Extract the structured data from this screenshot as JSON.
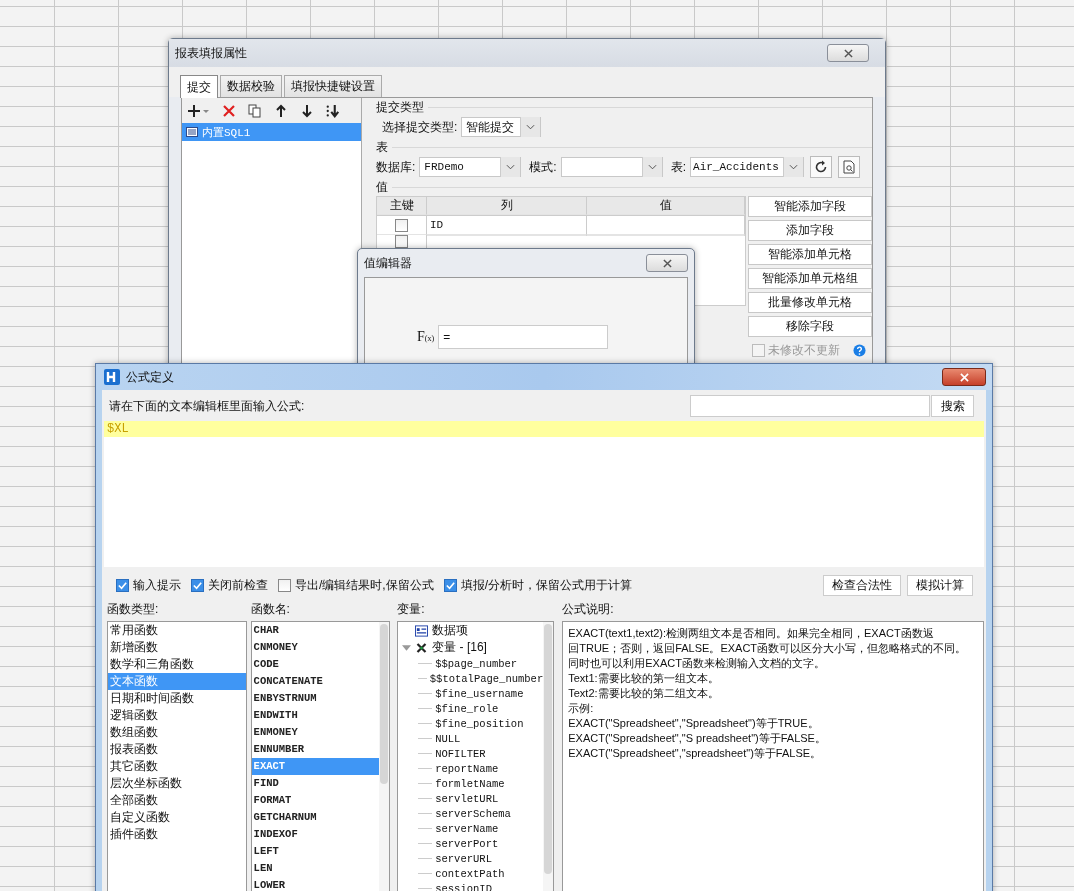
{
  "property_dialog": {
    "title": "报表填报属性",
    "tabs": [
      {
        "label": "提交",
        "selected": true
      },
      {
        "label": "数据校验",
        "selected": false
      },
      {
        "label": "填报快捷键设置",
        "selected": false
      }
    ],
    "submit_items": [
      {
        "label": "内置SQL1",
        "selected": true
      }
    ],
    "submit_type": {
      "heading": "提交类型",
      "label": "选择提交类型:",
      "value": "智能提交"
    },
    "table_section": {
      "heading": "表",
      "database_label": "数据库:",
      "database": "FRDemo",
      "schema_label": "模式:",
      "table_label": "表:",
      "table": "Air_Accidents"
    },
    "value_section": {
      "heading": "值",
      "columns": [
        "主键",
        "列",
        "值"
      ],
      "rows": [
        {
          "checked": false,
          "column": "ID"
        },
        {
          "checked": false
        }
      ],
      "buttons": [
        "智能添加字段",
        "添加字段",
        "智能添加单元格",
        "智能添加单元格组",
        "批量修改单元格",
        "移除字段"
      ],
      "unmodified_option": {
        "label": "未修改不更新",
        "checked": false,
        "disabled": true
      }
    }
  },
  "value_editor": {
    "title": "值编辑器",
    "fx_label": "F",
    "fx_sub": "(x)",
    "value": "="
  },
  "formula_dialog": {
    "title": "公式定义",
    "prompt": "请在下面的文本编辑框里面输入公式:",
    "search_button": "搜索",
    "formula": "$XL",
    "options": [
      {
        "label": "输入提示",
        "checked": true
      },
      {
        "label": "关闭前检查",
        "checked": true
      },
      {
        "label": "导出/编辑结果时,保留公式",
        "checked": false
      },
      {
        "label": "填报/分析时，保留公式用于计算",
        "checked": true
      }
    ],
    "action_buttons": [
      "检查合法性",
      "模拟计算"
    ],
    "function_types": {
      "heading": "函数类型:",
      "items": [
        {
          "label": "常用函数",
          "selected": false
        },
        {
          "label": "新增函数",
          "selected": false
        },
        {
          "label": "数学和三角函数",
          "selected": false
        },
        {
          "label": "文本函数",
          "selected": true
        },
        {
          "label": "日期和时间函数",
          "selected": false
        },
        {
          "label": "逻辑函数",
          "selected": false
        },
        {
          "label": "数组函数",
          "selected": false
        },
        {
          "label": "报表函数",
          "selected": false
        },
        {
          "label": "其它函数",
          "selected": false
        },
        {
          "label": "层次坐标函数",
          "selected": false
        },
        {
          "label": "全部函数",
          "selected": false
        },
        {
          "label": "自定义函数",
          "selected": false
        },
        {
          "label": "插件函数",
          "selected": false
        }
      ]
    },
    "function_names": {
      "heading": "函数名:",
      "items": [
        {
          "label": "CHAR",
          "selected": false
        },
        {
          "label": "CNMONEY",
          "selected": false
        },
        {
          "label": "CODE",
          "selected": false
        },
        {
          "label": "CONCATENATE",
          "selected": false
        },
        {
          "label": "ENBYSTRNUM",
          "selected": false
        },
        {
          "label": "ENDWITH",
          "selected": false
        },
        {
          "label": "ENMONEY",
          "selected": false
        },
        {
          "label": "ENNUMBER",
          "selected": false
        },
        {
          "label": "EXACT",
          "selected": true
        },
        {
          "label": "FIND",
          "selected": false
        },
        {
          "label": "FORMAT",
          "selected": false
        },
        {
          "label": "GETCHARNUM",
          "selected": false
        },
        {
          "label": "INDEXOF",
          "selected": false
        },
        {
          "label": "LEFT",
          "selected": false
        },
        {
          "label": "LEN",
          "selected": false
        },
        {
          "label": "LOWER",
          "selected": false
        }
      ]
    },
    "variables": {
      "heading": "变量:",
      "items": [
        {
          "label": "数据项",
          "kind": "data"
        },
        {
          "label": "变量 - [16]",
          "kind": "group",
          "expanded": true,
          "children": [
            {
              "label": "$$page_number"
            },
            {
              "label": "$$totalPage_number"
            },
            {
              "label": "$fine_username"
            },
            {
              "label": "$fine_role"
            },
            {
              "label": "$fine_position"
            },
            {
              "label": "NULL"
            },
            {
              "label": "NOFILTER"
            },
            {
              "label": "reportName"
            },
            {
              "label": "formletName"
            },
            {
              "label": "servletURL"
            },
            {
              "label": "serverSchema"
            },
            {
              "label": "serverName"
            },
            {
              "label": "serverPort"
            },
            {
              "label": "serverURL"
            },
            {
              "label": "contextPath"
            },
            {
              "label": "sessionID"
            }
          ]
        }
      ]
    },
    "description": {
      "heading": "公式说明:",
      "lines": [
        "EXACT(text1,text2):检测两组文本是否相同。如果完全相同，EXACT函数返",
        "回TRUE；否则，返回FALSE。EXACT函数可以区分大小写，但忽略格式的不同。",
        "同时也可以利用EXACT函数来检测输入文档的文字。",
        "Text1:需要比较的第一组文本。",
        "Text2:需要比较的第二组文本。",
        "示例:",
        "EXACT(\"Spreadsheet\",\"Spreadsheet\")等于TRUE。",
        "EXACT(\"Spreadsheet\",\"S preadsheet\")等于FALSE。",
        "EXACT(\"Spreadsheet\",\"spreadsheet\")等于FALSE。"
      ]
    }
  }
}
